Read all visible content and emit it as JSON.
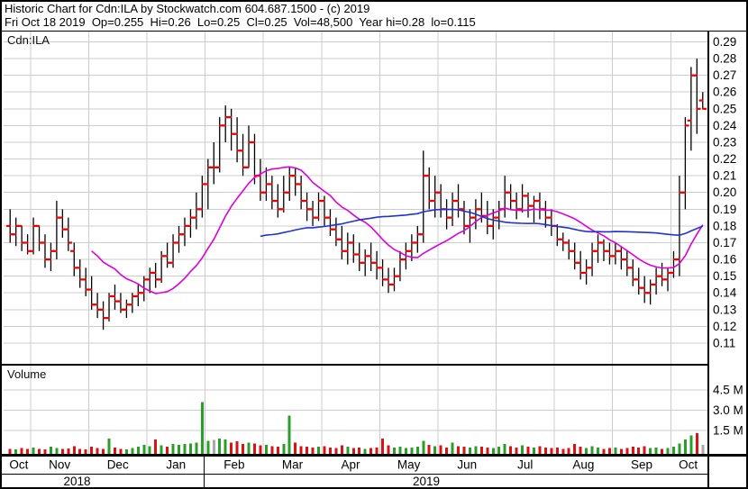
{
  "header": {
    "line1": "Historic Chart for Cdn:ILA by Stockwatch.com 604.687.1500 - (c) 2019",
    "line2": "Fri Oct 18 2019  Op=0.255  Hi=0.26  Lo=0.25  Cl=0.25  Vol=48,500  Year hi=0.28  lo=0.115"
  },
  "symbol_label": "Cdn:ILA",
  "volume_pane_label": "Volume",
  "price_axis": {
    "labels": [
      "0.29",
      "0.28",
      "0.27",
      "0.26",
      "0.25",
      "0.24",
      "0.23",
      "0.22",
      "0.21",
      "0.20",
      "0.19",
      "0.18",
      "0.17",
      "0.16",
      "0.15",
      "0.14",
      "0.13",
      "0.12",
      "0.11"
    ]
  },
  "volume_axis": {
    "labels": [
      "4.5 M",
      "3.0 M",
      "1.5 M"
    ],
    "values": [
      4.5,
      3.0,
      1.5
    ]
  },
  "colors": {
    "bar": "#000000",
    "tick": "#ee0000",
    "ma_short": "#dd00dd",
    "ma_long": "#2233cc",
    "vol_up": "#28a028",
    "vol_down": "#dd1111",
    "vol_flat": "#aaaaaa",
    "grid": "#cccccc",
    "frame": "#000000",
    "background": "#ffffff"
  },
  "chart_data": {
    "type": "ohlc+volume",
    "title": "Historic Chart for Cdn:ILA",
    "symbol": "Cdn:ILA",
    "last_quote": {
      "date": "Fri Oct 18 2019",
      "open": 0.255,
      "high": 0.26,
      "low": 0.25,
      "close": 0.25,
      "volume": 48500,
      "year_high": 0.28,
      "year_low": 0.115
    },
    "ylim": [
      0.11,
      0.29
    ],
    "volume_ylim_millions": [
      0,
      5.25
    ],
    "grid": true,
    "months": [
      "Oct",
      "Nov",
      "Dec",
      "Jan",
      "Feb",
      "Mar",
      "Apr",
      "May",
      "Jun",
      "Jul",
      "Aug",
      "Sep",
      "Oct"
    ],
    "bars_per_month": [
      4,
      10,
      10,
      10,
      10,
      10,
      10,
      10,
      10,
      10,
      10,
      10,
      6
    ],
    "years": [
      {
        "label": "2018",
        "from": 0,
        "to": 24
      },
      {
        "label": "2019",
        "from": 24,
        "to": 120
      }
    ],
    "bars_format": [
      "high",
      "low",
      "open",
      "close"
    ],
    "bars": [
      [
        0.19,
        0.17,
        0.18,
        0.175
      ],
      [
        0.185,
        0.168,
        0.175,
        0.18
      ],
      [
        0.18,
        0.165,
        0.18,
        0.17
      ],
      [
        0.175,
        0.163,
        0.17,
        0.165
      ],
      [
        0.185,
        0.163,
        0.165,
        0.18
      ],
      [
        0.18,
        0.165,
        0.18,
        0.17
      ],
      [
        0.175,
        0.155,
        0.17,
        0.16
      ],
      [
        0.17,
        0.153,
        0.16,
        0.165
      ],
      [
        0.195,
        0.16,
        0.165,
        0.185
      ],
      [
        0.19,
        0.173,
        0.185,
        0.178
      ],
      [
        0.185,
        0.165,
        0.178,
        0.17
      ],
      [
        0.17,
        0.15,
        0.165,
        0.155
      ],
      [
        0.16,
        0.143,
        0.155,
        0.148
      ],
      [
        0.155,
        0.138,
        0.148,
        0.142
      ],
      [
        0.15,
        0.13,
        0.142,
        0.133
      ],
      [
        0.14,
        0.125,
        0.133,
        0.13
      ],
      [
        0.135,
        0.118,
        0.13,
        0.125
      ],
      [
        0.14,
        0.123,
        0.125,
        0.138
      ],
      [
        0.145,
        0.13,
        0.138,
        0.135
      ],
      [
        0.14,
        0.128,
        0.135,
        0.13
      ],
      [
        0.136,
        0.125,
        0.13,
        0.133
      ],
      [
        0.14,
        0.128,
        0.133,
        0.138
      ],
      [
        0.145,
        0.132,
        0.138,
        0.14
      ],
      [
        0.15,
        0.135,
        0.14,
        0.148
      ],
      [
        0.155,
        0.14,
        0.148,
        0.152
      ],
      [
        0.158,
        0.143,
        0.152,
        0.148
      ],
      [
        0.165,
        0.146,
        0.148,
        0.162
      ],
      [
        0.17,
        0.155,
        0.162,
        0.158
      ],
      [
        0.175,
        0.155,
        0.158,
        0.17
      ],
      [
        0.18,
        0.164,
        0.17,
        0.175
      ],
      [
        0.185,
        0.168,
        0.175,
        0.18
      ],
      [
        0.19,
        0.173,
        0.18,
        0.185
      ],
      [
        0.2,
        0.178,
        0.185,
        0.19
      ],
      [
        0.21,
        0.185,
        0.19,
        0.205
      ],
      [
        0.22,
        0.19,
        0.205,
        0.215
      ],
      [
        0.23,
        0.205,
        0.215,
        0.215
      ],
      [
        0.245,
        0.212,
        0.215,
        0.24
      ],
      [
        0.252,
        0.23,
        0.24,
        0.245
      ],
      [
        0.25,
        0.225,
        0.245,
        0.235
      ],
      [
        0.245,
        0.218,
        0.235,
        0.225
      ],
      [
        0.235,
        0.21,
        0.225,
        0.215
      ],
      [
        0.24,
        0.215,
        0.215,
        0.23
      ],
      [
        0.235,
        0.205,
        0.23,
        0.21
      ],
      [
        0.22,
        0.195,
        0.21,
        0.2
      ],
      [
        0.215,
        0.195,
        0.2,
        0.205
      ],
      [
        0.21,
        0.19,
        0.205,
        0.195
      ],
      [
        0.205,
        0.185,
        0.195,
        0.19
      ],
      [
        0.21,
        0.188,
        0.19,
        0.2
      ],
      [
        0.215,
        0.195,
        0.2,
        0.21
      ],
      [
        0.215,
        0.198,
        0.21,
        0.205
      ],
      [
        0.21,
        0.19,
        0.205,
        0.195
      ],
      [
        0.2,
        0.183,
        0.195,
        0.19
      ],
      [
        0.195,
        0.18,
        0.19,
        0.185
      ],
      [
        0.2,
        0.183,
        0.185,
        0.195
      ],
      [
        0.198,
        0.18,
        0.195,
        0.185
      ],
      [
        0.19,
        0.174,
        0.185,
        0.178
      ],
      [
        0.185,
        0.168,
        0.178,
        0.172
      ],
      [
        0.18,
        0.16,
        0.172,
        0.165
      ],
      [
        0.176,
        0.157,
        0.165,
        0.17
      ],
      [
        0.175,
        0.158,
        0.17,
        0.163
      ],
      [
        0.17,
        0.153,
        0.163,
        0.158
      ],
      [
        0.166,
        0.15,
        0.158,
        0.162
      ],
      [
        0.17,
        0.153,
        0.162,
        0.158
      ],
      [
        0.165,
        0.148,
        0.158,
        0.155
      ],
      [
        0.16,
        0.144,
        0.155,
        0.148
      ],
      [
        0.155,
        0.14,
        0.148,
        0.145
      ],
      [
        0.155,
        0.141,
        0.145,
        0.15
      ],
      [
        0.165,
        0.147,
        0.15,
        0.16
      ],
      [
        0.17,
        0.154,
        0.16,
        0.165
      ],
      [
        0.175,
        0.159,
        0.165,
        0.17
      ],
      [
        0.18,
        0.164,
        0.17,
        0.175
      ],
      [
        0.225,
        0.17,
        0.175,
        0.21
      ],
      [
        0.215,
        0.19,
        0.21,
        0.195
      ],
      [
        0.21,
        0.185,
        0.195,
        0.2
      ],
      [
        0.205,
        0.185,
        0.2,
        0.19
      ],
      [
        0.196,
        0.178,
        0.19,
        0.185
      ],
      [
        0.2,
        0.18,
        0.185,
        0.195
      ],
      [
        0.205,
        0.185,
        0.195,
        0.19
      ],
      [
        0.195,
        0.175,
        0.19,
        0.18
      ],
      [
        0.19,
        0.17,
        0.18,
        0.185
      ],
      [
        0.196,
        0.178,
        0.185,
        0.19
      ],
      [
        0.2,
        0.182,
        0.19,
        0.186
      ],
      [
        0.195,
        0.175,
        0.186,
        0.18
      ],
      [
        0.19,
        0.172,
        0.18,
        0.185
      ],
      [
        0.195,
        0.178,
        0.185,
        0.19
      ],
      [
        0.21,
        0.185,
        0.19,
        0.2
      ],
      [
        0.205,
        0.19,
        0.2,
        0.195
      ],
      [
        0.2,
        0.184,
        0.195,
        0.19
      ],
      [
        0.205,
        0.188,
        0.19,
        0.198
      ],
      [
        0.2,
        0.185,
        0.198,
        0.192
      ],
      [
        0.198,
        0.182,
        0.192,
        0.195
      ],
      [
        0.2,
        0.184,
        0.195,
        0.19
      ],
      [
        0.195,
        0.179,
        0.19,
        0.185
      ],
      [
        0.19,
        0.174,
        0.185,
        0.18
      ],
      [
        0.181,
        0.168,
        0.18,
        0.172
      ],
      [
        0.176,
        0.165,
        0.172,
        0.17
      ],
      [
        0.172,
        0.16,
        0.17,
        0.165
      ],
      [
        0.17,
        0.154,
        0.165,
        0.158
      ],
      [
        0.165,
        0.148,
        0.158,
        0.152
      ],
      [
        0.16,
        0.145,
        0.152,
        0.155
      ],
      [
        0.17,
        0.15,
        0.155,
        0.165
      ],
      [
        0.175,
        0.158,
        0.165,
        0.17
      ],
      [
        0.172,
        0.159,
        0.17,
        0.165
      ],
      [
        0.17,
        0.157,
        0.165,
        0.162
      ],
      [
        0.17,
        0.157,
        0.162,
        0.165
      ],
      [
        0.168,
        0.154,
        0.165,
        0.16
      ],
      [
        0.165,
        0.15,
        0.16,
        0.155
      ],
      [
        0.16,
        0.144,
        0.155,
        0.148
      ],
      [
        0.155,
        0.139,
        0.148,
        0.143
      ],
      [
        0.15,
        0.134,
        0.143,
        0.14
      ],
      [
        0.148,
        0.133,
        0.14,
        0.145
      ],
      [
        0.155,
        0.139,
        0.145,
        0.15
      ],
      [
        0.158,
        0.144,
        0.15,
        0.148
      ],
      [
        0.155,
        0.141,
        0.148,
        0.152
      ],
      [
        0.165,
        0.149,
        0.152,
        0.16
      ],
      [
        0.21,
        0.15,
        0.16,
        0.2
      ],
      [
        0.245,
        0.19,
        0.2,
        0.24
      ],
      [
        0.275,
        0.225,
        0.243,
        0.27
      ],
      [
        0.28,
        0.235,
        0.27,
        0.25
      ],
      [
        0.26,
        0.25,
        0.255,
        0.25
      ]
    ],
    "volumes_millions": [
      0.15,
      0.1,
      0.2,
      0.12,
      0.25,
      0.15,
      0.1,
      0.3,
      0.2,
      0.12,
      0.18,
      0.35,
      0.15,
      0.1,
      0.3,
      0.2,
      0.15,
      0.9,
      0.25,
      0.15,
      0.1,
      0.2,
      0.3,
      0.45,
      0.35,
      0.85,
      0.4,
      0.3,
      0.5,
      0.45,
      0.5,
      0.55,
      0.6,
      3.6,
      0.75,
      0.8,
      0.9,
      0.85,
      0.6,
      0.7,
      0.5,
      0.6,
      0.55,
      0.4,
      0.45,
      0.35,
      0.3,
      0.5,
      2.6,
      0.6,
      0.35,
      0.3,
      0.25,
      0.3,
      0.35,
      0.25,
      0.2,
      0.4,
      0.3,
      0.2,
      0.25,
      0.15,
      0.2,
      0.25,
      0.9,
      0.4,
      0.25,
      0.3,
      0.2,
      0.25,
      0.3,
      0.75,
      0.45,
      0.35,
      0.4,
      0.25,
      0.6,
      0.35,
      0.3,
      0.25,
      0.35,
      0.3,
      0.25,
      0.2,
      0.3,
      0.5,
      0.35,
      0.25,
      0.4,
      0.3,
      0.25,
      0.35,
      0.25,
      0.2,
      0.25,
      0.15,
      0.2,
      0.5,
      0.3,
      0.2,
      0.35,
      0.25,
      0.15,
      0.2,
      0.25,
      0.15,
      0.2,
      0.3,
      0.25,
      0.35,
      0.2,
      0.25,
      0.15,
      0.2,
      0.3,
      0.55,
      0.85,
      1.15,
      1.3,
      0.45
    ],
    "moving_averages": [
      {
        "name": "short-ma",
        "window": 15,
        "color": "#dd00dd"
      },
      {
        "name": "long-ma",
        "window": 44,
        "color": "#2233cc"
      }
    ],
    "legend_position": "none"
  }
}
